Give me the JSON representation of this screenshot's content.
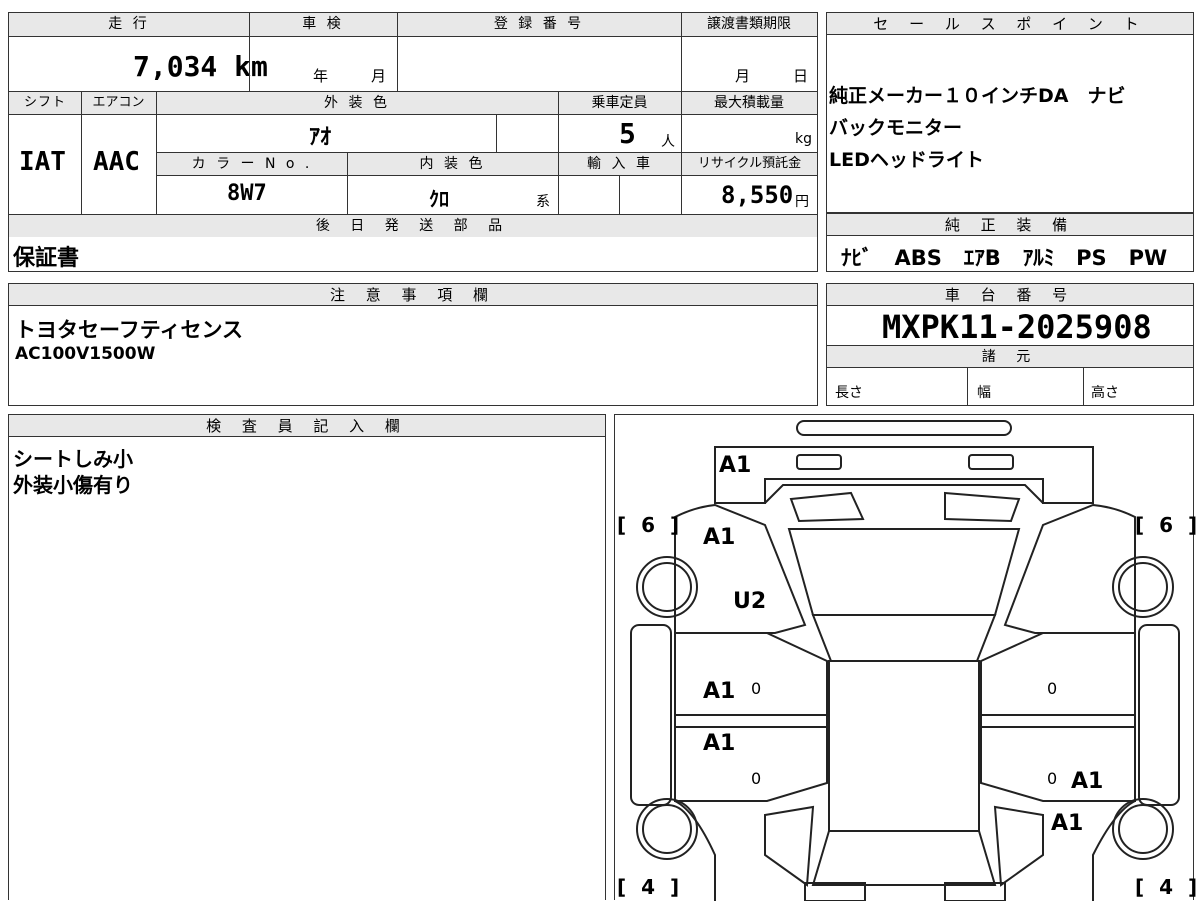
{
  "top_table": {
    "headers": {
      "mileage": "走 行",
      "inspection": "車 検",
      "registration": "登 録 番 号",
      "transfer_deadline": "譲渡書類期限",
      "shift": "シフト",
      "aircon": "エアコン",
      "exterior_color": "外 装 色",
      "capacity": "乗車定員",
      "max_load": "最大積載量",
      "color_no": "カ ラ ー N o .",
      "interior_color": "内 装 色",
      "import": "輸 入 車",
      "recycle": "リサイクル預託金",
      "later_parts": "後 日 発 送 部 品"
    },
    "values": {
      "mileage": "7,034 km",
      "inspection_year": "年",
      "inspection_month": "月",
      "transfer_month": "月",
      "transfer_day": "日",
      "shift": "IAT",
      "aircon": "AAC",
      "exterior_color": "ｱｵ",
      "capacity": "5",
      "capacity_unit": "人",
      "max_load_unit": "kg",
      "color_no": "8W7",
      "interior_color": "ｸﾛ",
      "interior_suffix": "系",
      "recycle": "8,550",
      "recycle_unit": "円",
      "later_parts": "保証書"
    }
  },
  "sales_points": {
    "header": "セ ー ル ス ポ イ ン ト",
    "lines": [
      "純正メーカー１０インチDA　ナビ",
      "バックモニター",
      "LEDヘッドライト"
    ]
  },
  "standard_equipment": {
    "header": "純 正 装 備",
    "items": [
      "ﾅﾋﾞ",
      "ABS",
      "ｴｱB",
      "ｱﾙﾐ",
      "PS",
      "PW"
    ]
  },
  "notes": {
    "header": "注 意 事 項 欄",
    "lines": [
      "トヨタセーフティセンス",
      "AC100V1500W"
    ]
  },
  "chassis": {
    "header": "車 台 番 号",
    "number": "MXPK11-2025908",
    "spec_header": "諸 元",
    "length": "長さ",
    "width": "幅",
    "height": "高さ"
  },
  "inspector": {
    "header": "検 査 員 記 入 欄",
    "lines": [
      "シートしみ小",
      "外装小傷有り"
    ]
  },
  "diagram": {
    "tread_fl": "[ 6 ]",
    "tread_fr": "[ 6 ]",
    "tread_rl": "[ 4 ]",
    "tread_rr": "[ 4 ]",
    "marks": {
      "hood": "A1",
      "fender_left": "A1",
      "fender_left2": "U2",
      "door_front_left": "A1",
      "door_front_left_num": "0",
      "door_rear_left": "A1",
      "door_rear_left_num": "0",
      "door_front_right_num": "0",
      "door_rear_right_num": "0",
      "door_rear_right": "A1",
      "quarter_right": "A1"
    }
  }
}
